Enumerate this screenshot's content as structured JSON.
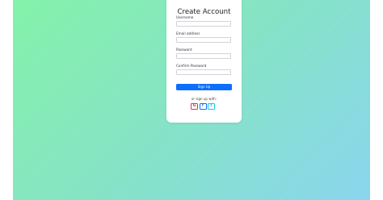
{
  "form": {
    "title": "Create Account",
    "fields": [
      {
        "label": "Username",
        "value": "",
        "placeholder": ""
      },
      {
        "label": "Email address",
        "value": "",
        "placeholder": ""
      },
      {
        "label": "Password",
        "value": "",
        "placeholder": ""
      },
      {
        "label": "Confirm Password",
        "value": "",
        "placeholder": ""
      }
    ],
    "submit_label": "Sign Up",
    "social_prompt": "or sign up with:",
    "social": [
      {
        "name": "google-icon",
        "glyph": "G",
        "color": "#dc3545"
      },
      {
        "name": "facebook-icon",
        "glyph": "f",
        "color": "#0d6efd"
      },
      {
        "name": "twitter-icon",
        "glyph": "t",
        "color": "#0dcaf0"
      }
    ]
  },
  "colors": {
    "gradient_start": "#84f2aa",
    "gradient_end": "#8ad5ee",
    "primary": "#0d6efd"
  }
}
